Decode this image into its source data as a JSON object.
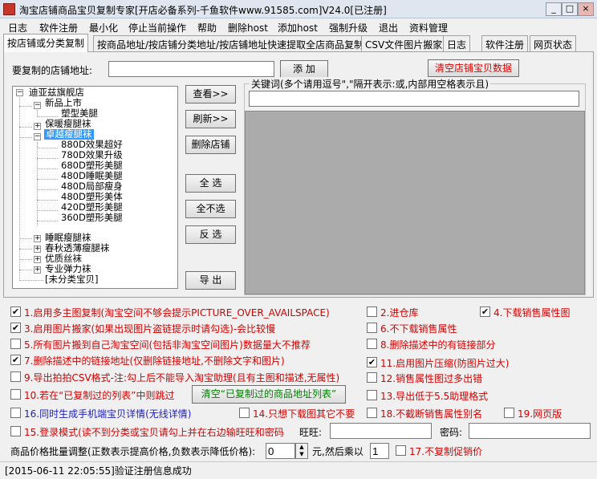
{
  "window": {
    "title": "淘宝店铺商品宝贝复制专家[开店必备系列-千鱼软件www.91585.com]V24.0[已注册]",
    "minimize": "_",
    "maximize": "□",
    "close": "×"
  },
  "menu": [
    "日志",
    "软件注册",
    "最小化",
    "停止当前操作",
    "帮助",
    "删除host",
    "添加host",
    "强制升级",
    "退出",
    "资料管理"
  ],
  "tabs": [
    "按店铺或分类复制",
    "按商品地址/按店铺分类地址/按店铺地址快速提取全店商品复制",
    "CSV文件图片搬家",
    "日志",
    "软件注册",
    "网页状态"
  ],
  "shop": {
    "url_label": "要复制的店铺地址:",
    "url_value": "",
    "add_button": "添 加",
    "clear_button": "清空店铺宝贝数据"
  },
  "tree": {
    "root": "迪亚兹旗舰店",
    "c1": "新品上市",
    "c1_1": "塑型美腿",
    "c2": "保暖瘦腿袜",
    "c3": "卓越瘦腿袜",
    "c3_1": "880D效果超好",
    "c3_2": "780D效果升级",
    "c3_3": "680D塑形美腿",
    "c3_4": "480D睡眠美腿",
    "c3_5": "480D局部瘦身",
    "c3_6": "480D塑形美体",
    "c3_7": "420D塑形美腿",
    "c3_8": "360D塑形美腿",
    "c4": "睡眠瘦腿袜",
    "c5": "春秋透薄瘦腿袜",
    "c6": "优质丝袜",
    "c7": "专业弹力袜",
    "c8": "[未分类宝贝]",
    "plus": "+",
    "minus": "−"
  },
  "actions": {
    "view": "查看>>",
    "refresh": "刷新>>",
    "delete_shop": "删除店铺",
    "select_all": "全 选",
    "select_none": "全不选",
    "invert": "反 选",
    "export": "导 出"
  },
  "keywords": {
    "label": "关键词(多个请用逗号\",\"隔开表示:或,内部用空格表示且)",
    "value": ""
  },
  "options": {
    "o1": "1.启用多主图复制(淘宝空间不够会提示PICTURE_OVER_AVAILSPACE)",
    "o2": "2.进仓库",
    "o3": "3.启用图片搬家(如果出现图片盗链提示时请勾选)-会比较慢",
    "o4": "4.下载销售属性图",
    "o5": "5.所有图片搬到自己淘宝空间(包括非淘宝空间图片)数据量大不推荐",
    "o6": "6.不下载销售属性",
    "o7": "7.删除描述中的链接地址(仅删除链接地址,不删除文字和图片)",
    "o8": "8.删除描述中的有链接部分",
    "o9": "9.导出拍拍CSV格式-注:勾上后不能导入淘宝助理(且有主图和描述,无属性)",
    "o10": "10.若在“已复制过的列表”中则跳过",
    "clear_copied": "清空“已复制过的商品地址列表”",
    "o11": "11.启用图片压缩(防图片过大)",
    "o12": "12.销售属性图过多出错",
    "o13": "13.导出低于5.5助理格式",
    "o14": "14.只想下载图其它不要",
    "o16": "16.同时生成手机端宝贝详情(无线详情)",
    "o18": "18.不截断销售属性别名",
    "o19": "19.网页版",
    "o15": "15.登录模式(读不到分类或宝贝请勾上并在右边输旺旺和密码",
    "wangwang_label": "旺旺:",
    "password_label": "密码:",
    "price_label": "商品价格批量调整(正数表示提高价格,负数表示降低价格):",
    "price_value": "0",
    "multiply_label": "元,然后乘以",
    "multiply_value": "1",
    "o17": "17.不复制促销价",
    "checked": "✔",
    "spin_up": "▲",
    "spin_down": "▼"
  },
  "status": "[2015-06-11 22:05:55]验证注册信息成功"
}
